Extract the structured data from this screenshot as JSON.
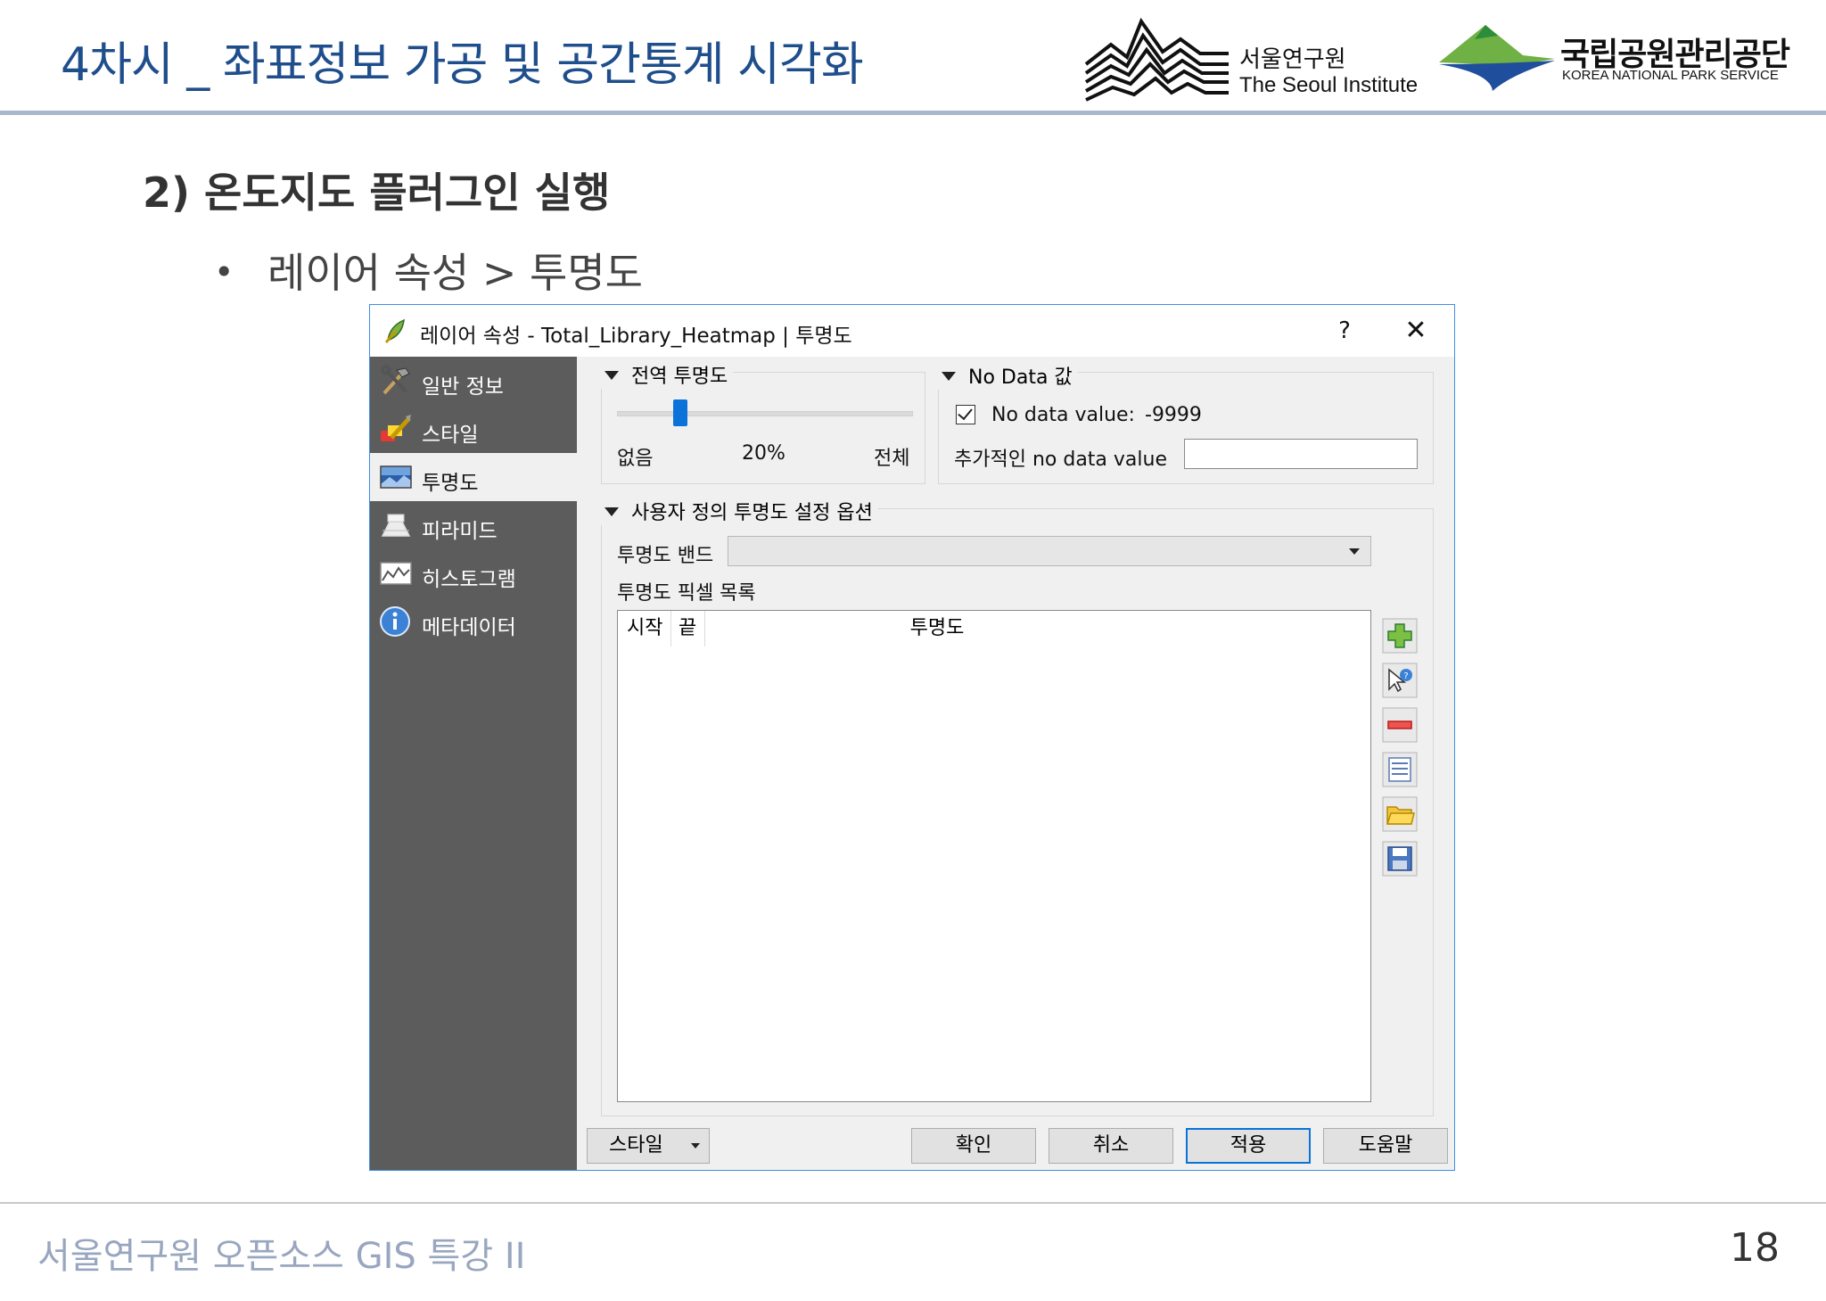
{
  "slide": {
    "title": "4차시 _ 좌표정보 가공 및 공간통계 시각화",
    "section_heading": "2) 온도지도 플러그인 실행",
    "bullet": "레이어 속성 > 투명도",
    "footer": "서울연구원 오픈소스 GIS 특강 II",
    "page_number": "18",
    "logos": {
      "seoul_institute_ko": "서울연구원",
      "seoul_institute_en": "The Seoul Institute",
      "knps_ko": "국립공원관리공단",
      "knps_en": "KOREA NATIONAL PARK SERVICE"
    },
    "colors": {
      "title": "#1f4e8c",
      "footer": "#98a6bf",
      "accent_blue": "#0a72d8",
      "sidebar": "#5c5c5c"
    }
  },
  "dialog": {
    "title": "레이어 속성 - Total_Library_Heatmap | 투명도",
    "help_label": "?",
    "close_label": "✕",
    "sidebar": {
      "items": [
        {
          "label": "일반 정보",
          "icon": "tools-icon"
        },
        {
          "label": "스타일",
          "icon": "paintbrush-icon"
        },
        {
          "label": "투명도",
          "icon": "transparency-icon",
          "active": true
        },
        {
          "label": "피라미드",
          "icon": "pyramid-icon"
        },
        {
          "label": "히스토그램",
          "icon": "histogram-icon"
        },
        {
          "label": "메타데이터",
          "icon": "info-icon"
        }
      ]
    },
    "global_transparency": {
      "title": "전역 투명도",
      "value_fraction": 0.2,
      "min_label": "없음",
      "value_label": "20%",
      "max_label": "전체"
    },
    "no_data": {
      "title": "No Data 값",
      "checkbox_label": "No data value:",
      "checked": true,
      "value": "-9999",
      "additional_label": "추가적인  no data value",
      "additional_value": ""
    },
    "custom": {
      "title": "사용자 정의 투명도 설정 옵션",
      "band_label": "투명도 밴드",
      "band_value": "",
      "pixel_list_label": "투명도 픽셀 목록",
      "columns": [
        "시작",
        "끝",
        "투명도"
      ],
      "rows": []
    },
    "buttons": {
      "style": "스타일",
      "ok": "확인",
      "cancel": "취소",
      "apply": "적용",
      "help": "도움말"
    }
  }
}
